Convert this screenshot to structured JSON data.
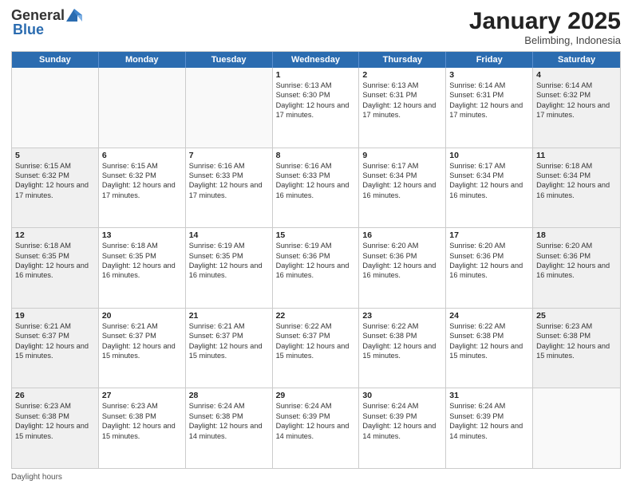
{
  "logo": {
    "general": "General",
    "blue": "Blue"
  },
  "title": "January 2025",
  "location": "Belimbing, Indonesia",
  "days_of_week": [
    "Sunday",
    "Monday",
    "Tuesday",
    "Wednesday",
    "Thursday",
    "Friday",
    "Saturday"
  ],
  "footer_label": "Daylight hours",
  "weeks": [
    [
      {
        "day": "",
        "info": "",
        "empty": true
      },
      {
        "day": "",
        "info": "",
        "empty": true
      },
      {
        "day": "",
        "info": "",
        "empty": true
      },
      {
        "day": "1",
        "info": "Sunrise: 6:13 AM\nSunset: 6:30 PM\nDaylight: 12 hours and 17 minutes."
      },
      {
        "day": "2",
        "info": "Sunrise: 6:13 AM\nSunset: 6:31 PM\nDaylight: 12 hours and 17 minutes."
      },
      {
        "day": "3",
        "info": "Sunrise: 6:14 AM\nSunset: 6:31 PM\nDaylight: 12 hours and 17 minutes."
      },
      {
        "day": "4",
        "info": "Sunrise: 6:14 AM\nSunset: 6:32 PM\nDaylight: 12 hours and 17 minutes."
      }
    ],
    [
      {
        "day": "5",
        "info": "Sunrise: 6:15 AM\nSunset: 6:32 PM\nDaylight: 12 hours and 17 minutes."
      },
      {
        "day": "6",
        "info": "Sunrise: 6:15 AM\nSunset: 6:32 PM\nDaylight: 12 hours and 17 minutes."
      },
      {
        "day": "7",
        "info": "Sunrise: 6:16 AM\nSunset: 6:33 PM\nDaylight: 12 hours and 17 minutes."
      },
      {
        "day": "8",
        "info": "Sunrise: 6:16 AM\nSunset: 6:33 PM\nDaylight: 12 hours and 16 minutes."
      },
      {
        "day": "9",
        "info": "Sunrise: 6:17 AM\nSunset: 6:34 PM\nDaylight: 12 hours and 16 minutes."
      },
      {
        "day": "10",
        "info": "Sunrise: 6:17 AM\nSunset: 6:34 PM\nDaylight: 12 hours and 16 minutes."
      },
      {
        "day": "11",
        "info": "Sunrise: 6:18 AM\nSunset: 6:34 PM\nDaylight: 12 hours and 16 minutes."
      }
    ],
    [
      {
        "day": "12",
        "info": "Sunrise: 6:18 AM\nSunset: 6:35 PM\nDaylight: 12 hours and 16 minutes."
      },
      {
        "day": "13",
        "info": "Sunrise: 6:18 AM\nSunset: 6:35 PM\nDaylight: 12 hours and 16 minutes."
      },
      {
        "day": "14",
        "info": "Sunrise: 6:19 AM\nSunset: 6:35 PM\nDaylight: 12 hours and 16 minutes."
      },
      {
        "day": "15",
        "info": "Sunrise: 6:19 AM\nSunset: 6:36 PM\nDaylight: 12 hours and 16 minutes."
      },
      {
        "day": "16",
        "info": "Sunrise: 6:20 AM\nSunset: 6:36 PM\nDaylight: 12 hours and 16 minutes."
      },
      {
        "day": "17",
        "info": "Sunrise: 6:20 AM\nSunset: 6:36 PM\nDaylight: 12 hours and 16 minutes."
      },
      {
        "day": "18",
        "info": "Sunrise: 6:20 AM\nSunset: 6:36 PM\nDaylight: 12 hours and 16 minutes."
      }
    ],
    [
      {
        "day": "19",
        "info": "Sunrise: 6:21 AM\nSunset: 6:37 PM\nDaylight: 12 hours and 15 minutes."
      },
      {
        "day": "20",
        "info": "Sunrise: 6:21 AM\nSunset: 6:37 PM\nDaylight: 12 hours and 15 minutes."
      },
      {
        "day": "21",
        "info": "Sunrise: 6:21 AM\nSunset: 6:37 PM\nDaylight: 12 hours and 15 minutes."
      },
      {
        "day": "22",
        "info": "Sunrise: 6:22 AM\nSunset: 6:37 PM\nDaylight: 12 hours and 15 minutes."
      },
      {
        "day": "23",
        "info": "Sunrise: 6:22 AM\nSunset: 6:38 PM\nDaylight: 12 hours and 15 minutes."
      },
      {
        "day": "24",
        "info": "Sunrise: 6:22 AM\nSunset: 6:38 PM\nDaylight: 12 hours and 15 minutes."
      },
      {
        "day": "25",
        "info": "Sunrise: 6:23 AM\nSunset: 6:38 PM\nDaylight: 12 hours and 15 minutes."
      }
    ],
    [
      {
        "day": "26",
        "info": "Sunrise: 6:23 AM\nSunset: 6:38 PM\nDaylight: 12 hours and 15 minutes."
      },
      {
        "day": "27",
        "info": "Sunrise: 6:23 AM\nSunset: 6:38 PM\nDaylight: 12 hours and 15 minutes."
      },
      {
        "day": "28",
        "info": "Sunrise: 6:24 AM\nSunset: 6:38 PM\nDaylight: 12 hours and 14 minutes."
      },
      {
        "day": "29",
        "info": "Sunrise: 6:24 AM\nSunset: 6:39 PM\nDaylight: 12 hours and 14 minutes."
      },
      {
        "day": "30",
        "info": "Sunrise: 6:24 AM\nSunset: 6:39 PM\nDaylight: 12 hours and 14 minutes."
      },
      {
        "day": "31",
        "info": "Sunrise: 6:24 AM\nSunset: 6:39 PM\nDaylight: 12 hours and 14 minutes."
      },
      {
        "day": "",
        "info": "",
        "empty": true
      }
    ]
  ]
}
